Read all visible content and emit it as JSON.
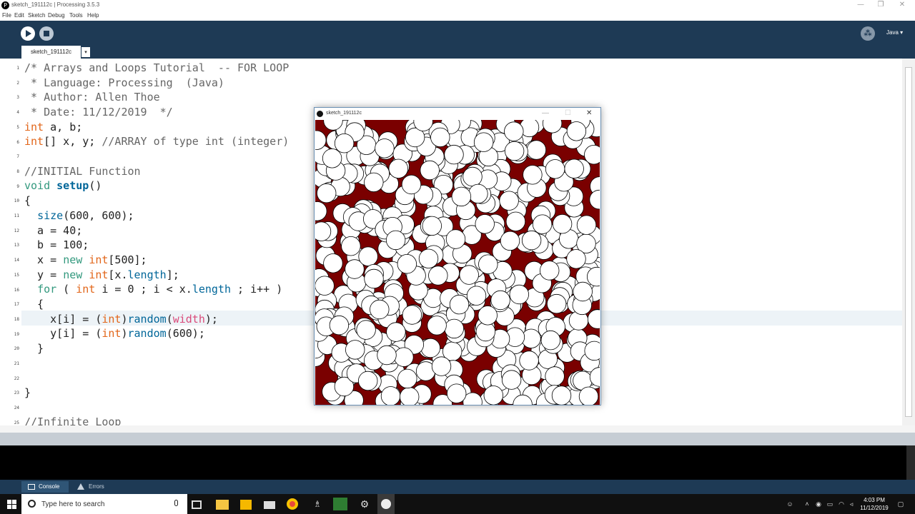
{
  "window": {
    "title": "sketch_191112c | Processing 3.5.3",
    "minimize": "—",
    "maximize": "❐",
    "close": "✕"
  },
  "menu": [
    "File",
    "Edit",
    "Sketch",
    "Debug",
    "Tools",
    "Help"
  ],
  "toolbar": {
    "run_icon": "play-icon",
    "stop_icon": "stop-icon",
    "debug_icon": "butterfly-debug-icon",
    "mode": "Java ▾"
  },
  "tabs": {
    "active": "sketch_191112c",
    "menu_glyph": "▾"
  },
  "editor": {
    "line_numbers": [
      "1",
      "2",
      "3",
      "4",
      "5",
      "6",
      "7",
      "8",
      "9",
      "10",
      "11",
      "12",
      "13",
      "14",
      "15",
      "16",
      "17",
      "18",
      "19",
      "20",
      "21",
      "22",
      "23",
      "24",
      "25"
    ],
    "highlighted_line": 18,
    "visible_line_25": "//Infinite Loop"
  },
  "sketch_window": {
    "title": "sketch_191112c",
    "minimize": "—",
    "maximize": "☐",
    "close": "✕",
    "background_color": "#7a0000",
    "circle_color": "#ffffff"
  },
  "console_tabs": {
    "console": "Console",
    "errors": "Errors"
  },
  "taskbar": {
    "search_placeholder": "Type here to search",
    "time": "4:03 PM",
    "date": "11/12/2019"
  },
  "colors": {
    "toolbar": "#1e3a55",
    "keyword": "#33997e",
    "function": "#006699",
    "comment": "#666666"
  }
}
